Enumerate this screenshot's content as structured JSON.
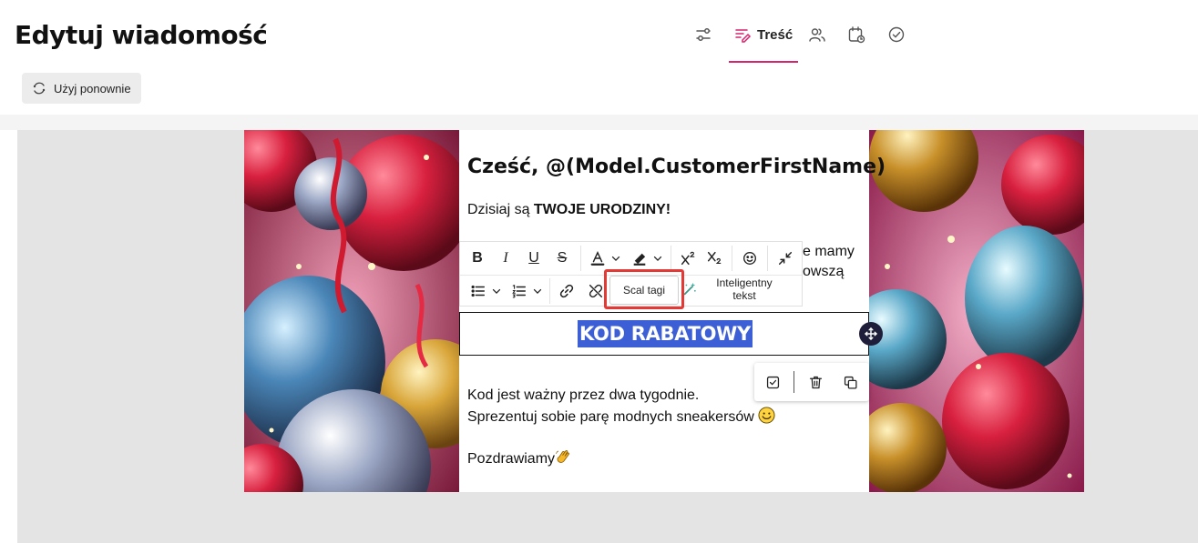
{
  "header": {
    "title": "Edytuj wiadomość",
    "steps": [
      {
        "icon": "filters-icon",
        "label": ""
      },
      {
        "icon": "content-icon",
        "label": "Treść",
        "active": true
      },
      {
        "icon": "users-icon",
        "label": ""
      },
      {
        "icon": "schedule-icon",
        "label": ""
      },
      {
        "icon": "check-circle-icon",
        "label": ""
      }
    ],
    "accent_color": "#d6246e"
  },
  "toolbar": {
    "reuse_label": "Użyj ponownie"
  },
  "email": {
    "greeting": "Cześć, @(Model.CustomerFirstName)",
    "line1_prefix": "Dzisiaj są ",
    "line1_bold": "TWOJE URODZINY!",
    "partial_right_1": "e mamy",
    "partial_right_2": "owszą",
    "discount_code": "KOD RABATOWY",
    "validity": "Kod jest ważny przez dwa tygodnie.",
    "gift": "Sprezentuj sobie parę modnych sneakersów",
    "regards": "Pozdrawiamy",
    "code_highlight_color": "#3d5fd6"
  },
  "editor_toolbar": {
    "row1": [
      "bold-icon",
      "italic-icon",
      "underline-icon",
      "strikethrough-icon",
      "text-color-icon",
      "highlight-color-icon",
      "superscript-icon",
      "subscript-icon",
      "emoji-icon",
      "collapse-icon"
    ],
    "row2": [
      "bullet-list-icon",
      "numbered-list-icon",
      "link-icon",
      "unlink-icon",
      "sparkle-icon"
    ],
    "bold": "B",
    "italic": "I",
    "underline": "U",
    "strike": "S",
    "merge_tags_label": "Scal tagi",
    "smart_text_line1": "Inteligentny",
    "smart_text_line2": "tekst",
    "highlight_box_color": "#e53935"
  },
  "block_actions": [
    "select-icon",
    "trash-icon",
    "duplicate-icon"
  ]
}
